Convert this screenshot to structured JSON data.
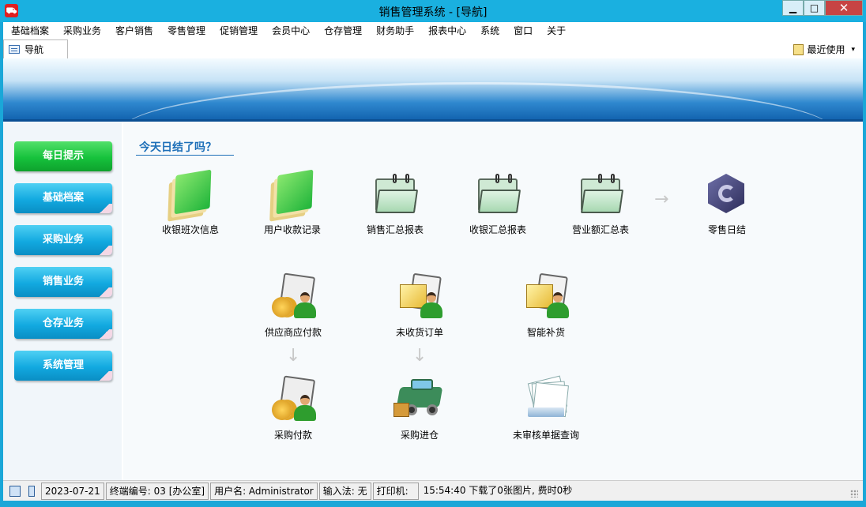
{
  "window": {
    "title": "销售管理系统 - [导航]",
    "minimize": "▁",
    "maximize": "□",
    "close": "✕",
    "app_icon": "cart-icon"
  },
  "menu": [
    "基础档案",
    "采购业务",
    "客户销售",
    "零售管理",
    "促销管理",
    "会员中心",
    "仓存管理",
    "财务助手",
    "报表中心",
    "系统",
    "窗口",
    "关于"
  ],
  "tabs": [
    {
      "label": "导航"
    }
  ],
  "recent": {
    "label": "最近使用",
    "caret": "▾"
  },
  "sidebar": {
    "items": [
      {
        "label": "每日提示",
        "active": true
      },
      {
        "label": "基础档案",
        "active": false
      },
      {
        "label": "采购业务",
        "active": false
      },
      {
        "label": "销售业务",
        "active": false
      },
      {
        "label": "仓存业务",
        "active": false
      },
      {
        "label": "系统管理",
        "active": false
      }
    ]
  },
  "section": {
    "title": "今天日结了吗？"
  },
  "row1": [
    "收银班次信息",
    "用户收款记录",
    "销售汇总报表",
    "收银汇总报表",
    "营业额汇总表",
    "零售日结"
  ],
  "row2": [
    "供应商应付款",
    "未收货订单",
    "智能补货"
  ],
  "row3": [
    "采购付款",
    "采购进仓",
    "未审核单据查询"
  ],
  "arrows": {
    "right": "→",
    "down": "↓"
  },
  "status": {
    "date": "2023-07-21",
    "terminal": "终端编号: 03 [办公室]",
    "user": "用户名: Administrator",
    "ime": "输入法: 无",
    "printer": "打印机:",
    "message": "15:54:40 下载了0张图片, 费时0秒"
  },
  "colors": {
    "accent": "#1ab0e0",
    "active_nav": "#16c23c",
    "nav": "#12a9e0",
    "section_title": "#1d6fb8"
  }
}
